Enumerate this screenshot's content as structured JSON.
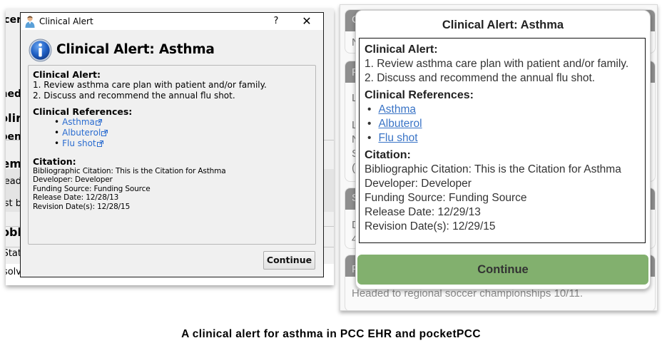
{
  "left_panel": {
    "background_fragments": [
      "cer",
      "ned",
      "olir",
      "pen",
      "em",
      "ead",
      "ost b",
      "obl",
      "Stat",
      "solv"
    ],
    "window": {
      "title": "Clinical Alert",
      "help_button": "?",
      "close_button": "✕",
      "title_icon": "user-doctor-icon",
      "heading_icon": "info-icon",
      "heading": "Clinical Alert: Asthma",
      "sections": {
        "alert_heading": "Clinical Alert:",
        "alert_lines": [
          "1. Review asthma care plan with patient and/or family.",
          "2. Discuss and recommend the annual flu shot."
        ],
        "references_heading": "Clinical References:",
        "references": [
          "Asthma",
          "Albuterol",
          "Flu shot"
        ],
        "citation_heading": "Citation:",
        "citation_lines": [
          "Bibliographic Citation: This is the Citation for Asthma",
          "Developer: Developer",
          "Funding Source: Funding Source",
          "Release Date: 12/28/13",
          "Revision Date(s): 12/28/15"
        ]
      },
      "continue_label": "Continue"
    }
  },
  "right_panel": {
    "background_fragments": [
      "C",
      "N",
      "F",
      "L",
      "L",
      "N",
      "S",
      "(",
      "S",
      "D",
      "4",
      "F"
    ],
    "footer_text": "Headed to regional soccer championships 10/11.",
    "modal": {
      "title": "Clinical Alert: Asthma",
      "alert_heading": "Clinical Alert:",
      "alert_lines": [
        "1. Review asthma care plan with patient and/or family.",
        "2. Discuss and recommend the annual flu shot."
      ],
      "references_heading": "Clinical References:",
      "references": [
        "Asthma",
        "Albuterol",
        "Flu shot"
      ],
      "citation_heading": "Citation:",
      "citation_lines": [
        "Bibliographic Citation: This is the Citation for Asthma",
        "Developer: Developer",
        "Funding Source: Funding Source",
        "Release Date: 12/29/13",
        "Revision Date(s): 12/29/15"
      ],
      "continue_label": "Continue",
      "continue_color": "#82b06e"
    }
  },
  "caption": "A clinical alert for asthma in PCC EHR and pocketPCC",
  "colors": {
    "link_desktop": "#2a6cd0",
    "link_mobile": "#3a74c6",
    "card_header": "#8e8e8e"
  }
}
